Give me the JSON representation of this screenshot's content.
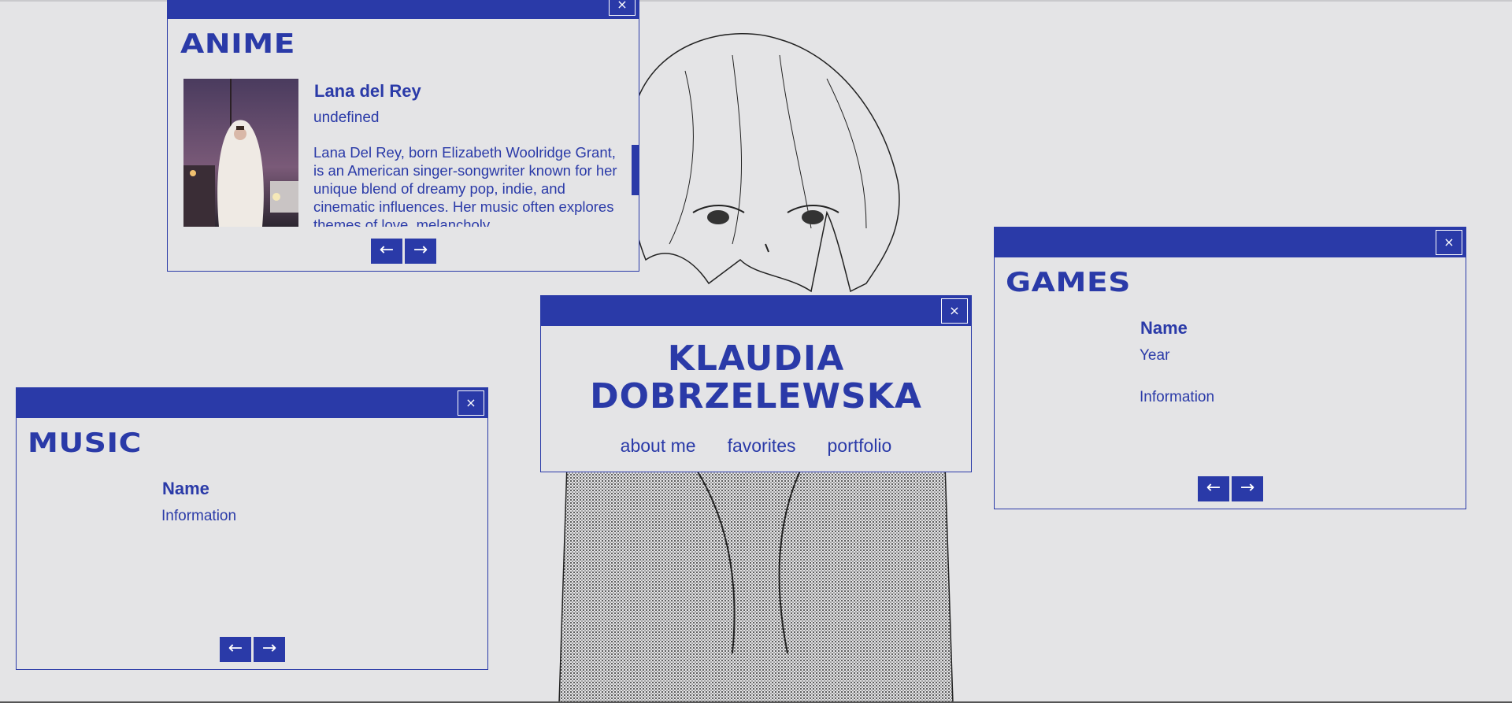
{
  "colors": {
    "accent": "#2a3aa8",
    "background": "#e4e4e6"
  },
  "close_icon": "×",
  "anime": {
    "title": "ANIME",
    "name": "Lana del Rey",
    "subtitle": "undefined",
    "description": "Lana Del Rey, born Elizabeth Woolridge Grant, is an American singer-songwriter known for her unique blend of dreamy pop, indie, and cinematic influences. Her music often explores themes of love, melancholy",
    "prev": "←",
    "next": "→"
  },
  "main": {
    "title_line1": "KLAUDIA",
    "title_line2": "DOBRZELEWSKA",
    "nav": [
      "about me",
      "favorites",
      "portfolio"
    ]
  },
  "games": {
    "title": "GAMES",
    "name": "Name",
    "year": "Year",
    "info": "Information",
    "prev": "←",
    "next": "→"
  },
  "music": {
    "title": "MUSIC",
    "name": "Name",
    "info": "Information",
    "prev": "←",
    "next": "→"
  }
}
